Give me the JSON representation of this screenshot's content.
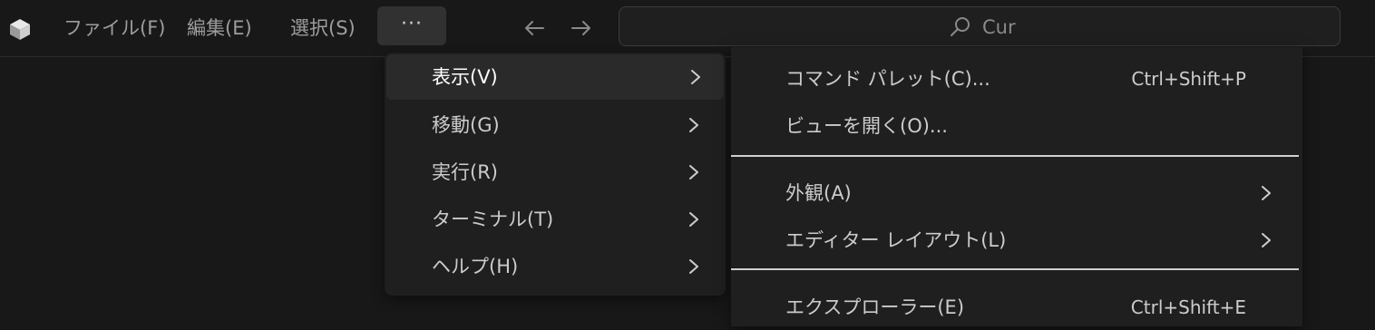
{
  "titlebar": {
    "menus": [
      "ファイル(F)",
      "編集(E)",
      "選択(S)"
    ],
    "more_label": "···",
    "search_text": "Cur"
  },
  "menu": {
    "items": [
      {
        "label": "表示(V)"
      },
      {
        "label": "移動(G)"
      },
      {
        "label": "実行(R)"
      },
      {
        "label": "ターミナル(T)"
      },
      {
        "label": "ヘルプ(H)"
      }
    ]
  },
  "submenu": {
    "items": [
      {
        "label": "コマンド パレット(C)...",
        "shortcut": "Ctrl+Shift+P"
      },
      {
        "label": "ビューを開く(O)..."
      },
      {
        "label": "外観(A)"
      },
      {
        "label": "エディター レイアウト(L)"
      },
      {
        "label": "エクスプローラー(E)",
        "shortcut": "Ctrl+Shift+E"
      }
    ]
  },
  "icons": {
    "logo": "cube-logo-icon",
    "back": "arrow-left-icon",
    "forward": "arrow-right-icon",
    "search": "search-icon",
    "chevron": "chevron-right-icon"
  },
  "colors": {
    "background": "#181818",
    "menu_background": "#1f1f1f",
    "active_row": "#2a2a2a",
    "text": "#cccccc"
  }
}
